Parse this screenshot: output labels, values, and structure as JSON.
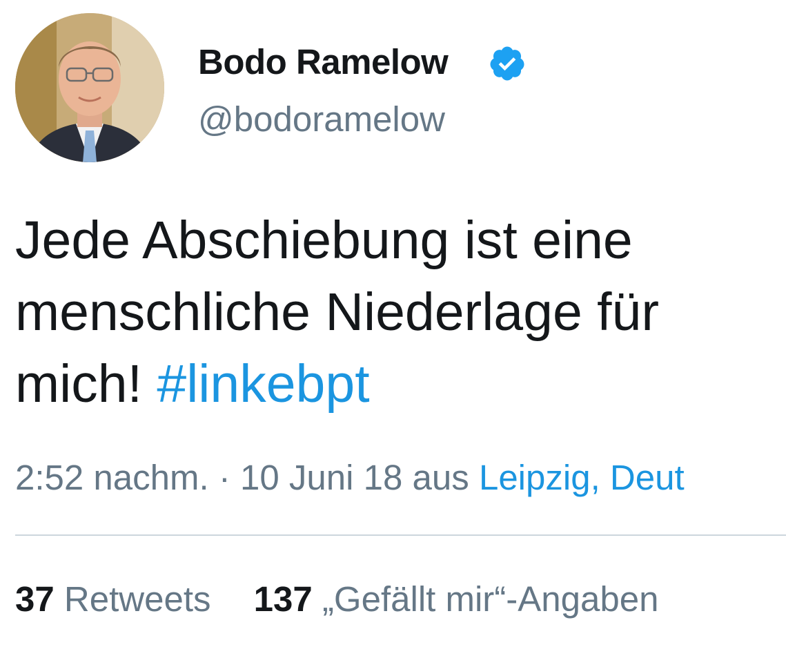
{
  "user": {
    "display_name": "Bodo Ramelow",
    "handle": "@bodoramelow",
    "verified": true,
    "verified_icon": "verified-badge-icon"
  },
  "tweet": {
    "text_lines": [
      "Jede Abschiebung ist eine",
      "menschliche Niederlage für",
      "mich!"
    ],
    "hashtag": "#linkebpt"
  },
  "meta": {
    "time": "2:52 nachm.",
    "separator": "·",
    "date": "10 Juni 18",
    "from_label": "aus",
    "location": "Leipzig, Deut"
  },
  "stats": {
    "retweets_count": "37",
    "retweets_label": "Retweets",
    "likes_count": "137",
    "likes_label": "„Gefällt mir“-Angaben"
  },
  "colors": {
    "text": "#14171a",
    "secondary": "#657786",
    "link": "#1b95e0",
    "verified": "#1da1f2",
    "divider": "#ccd6dd"
  }
}
